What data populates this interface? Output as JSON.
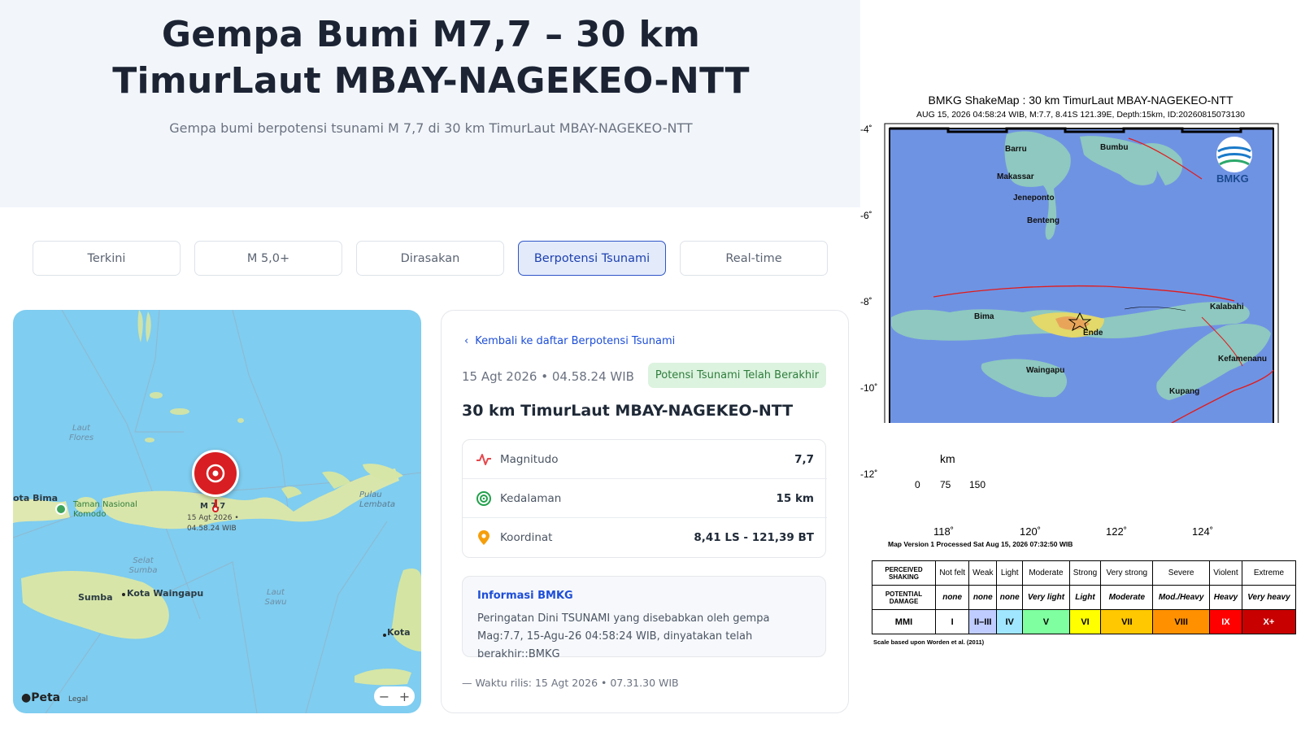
{
  "page": {
    "title_line1": "Gempa Bumi M7,7 – 30 km",
    "title_line2": "TimurLaut MBAY-NAGEKEO-NTT",
    "subtitle": "Gempa bumi berpotensi tsunami M 7,7 di 30 km TimurLaut MBAY-NAGEKEO-NTT"
  },
  "tabs": [
    {
      "label": "Terkini",
      "active": false
    },
    {
      "label": "M 5,0+",
      "active": false
    },
    {
      "label": "Dirasakan",
      "active": false
    },
    {
      "label": "Berpotensi Tsunami",
      "active": true
    },
    {
      "label": "Real-time",
      "active": false
    }
  ],
  "map": {
    "sea_labels": [
      "Laut Flores",
      "Selat Sumba",
      "Laut Sawu"
    ],
    "places": {
      "bima": "ota Bima",
      "komodo": "Taman Nasional Komodo",
      "lembata": "Pulau Lembata",
      "sumba": "Sumba",
      "waingapu": "Kota Waingapu",
      "kota": "Kota"
    },
    "marker": {
      "label": "M 7,7",
      "date": "15 Agt 2026 •",
      "time": "04.58.24 WIB"
    },
    "attribution": "Peta",
    "legal": "Legal",
    "zoom_out": "−",
    "zoom_in": "+"
  },
  "detail": {
    "back_link": "Kembali ke daftar Berpotensi Tsunami",
    "datetime": "15 Agt 2026 • 04.58.24 WIB",
    "status_badge": "Potensi Tsunami Telah Berakhir",
    "location": "30 km TimurLaut MBAY-NAGEKEO-NTT",
    "stats": [
      {
        "icon": "waveform-icon",
        "label": "Magnitudo",
        "value": "7,7"
      },
      {
        "icon": "target-icon",
        "label": "Kedalaman",
        "value": "15 km"
      },
      {
        "icon": "location-pin-icon",
        "label": "Koordinat",
        "value": "8,41 LS - 121,39 BT"
      }
    ],
    "info_title": "Informasi BMKG",
    "info_text": "Peringatan Dini TSUNAMI yang disebabkan oleh gempa Mag:7.7, 15-Agu-26 04:58:24 WIB, dinyatakan telah berakhir::BMKG",
    "release": "— Waktu rilis: 15 Agt 2026 • 07.31.30 WIB"
  },
  "shakemap": {
    "title": "BMKG ShakeMap : 30 km TimurLaut MBAY-NAGEKEO-NTT",
    "subtitle": "AUG 15, 2026 04:58:24 WIB, M:7.7, 8.41S 121.39E, Depth:15km, ID:20260815073130",
    "logo": "BMKG",
    "y_ticks": [
      "-4˚",
      "-6˚",
      "-8˚",
      "-10˚",
      "-12˚"
    ],
    "x_ticks": [
      "118˚",
      "120˚",
      "122˚",
      "124˚"
    ],
    "scale_unit": "km",
    "scale_ticks": [
      "0",
      "75",
      "150"
    ],
    "places": {
      "barru": "Barru",
      "bumbu": "Bumbu",
      "makassar": "Makassar",
      "jeneponto": "Jeneponto",
      "benteng": "Benteng",
      "bima": "Bima",
      "ende": "Ende",
      "kalabahi": "Kalabahi",
      "waingapu": "Waingapu",
      "kefamenanu": "Kefamenanu",
      "kupang": "Kupang"
    },
    "map_version": "Map Version 1 Processed Sat Aug 15, 2026 07:32:50 WIB",
    "table": {
      "row1_head": "PERCEIVED SHAKING",
      "row2_head": "POTENTIAL DAMAGE",
      "row3_head": "MMI",
      "shaking": [
        "Not felt",
        "Weak",
        "Light",
        "Moderate",
        "Strong",
        "Very strong",
        "Severe",
        "Violent",
        "Extreme"
      ],
      "damage": [
        "none",
        "none",
        "none",
        "Very light",
        "Light",
        "Moderate",
        "Mod./Heavy",
        "Heavy",
        "Very heavy"
      ],
      "mmi": [
        "I",
        "II–III",
        "IV",
        "V",
        "VI",
        "VII",
        "VIII",
        "IX",
        "X+"
      ],
      "mmi_colors": [
        "#ffffff",
        "#bfccff",
        "#a0e6ff",
        "#80ffa0",
        "#ffff00",
        "#ffc800",
        "#ff9100",
        "#ff0000",
        "#c80000"
      ]
    },
    "scale_note": "Scale based upon Worden et al. (2011)"
  }
}
